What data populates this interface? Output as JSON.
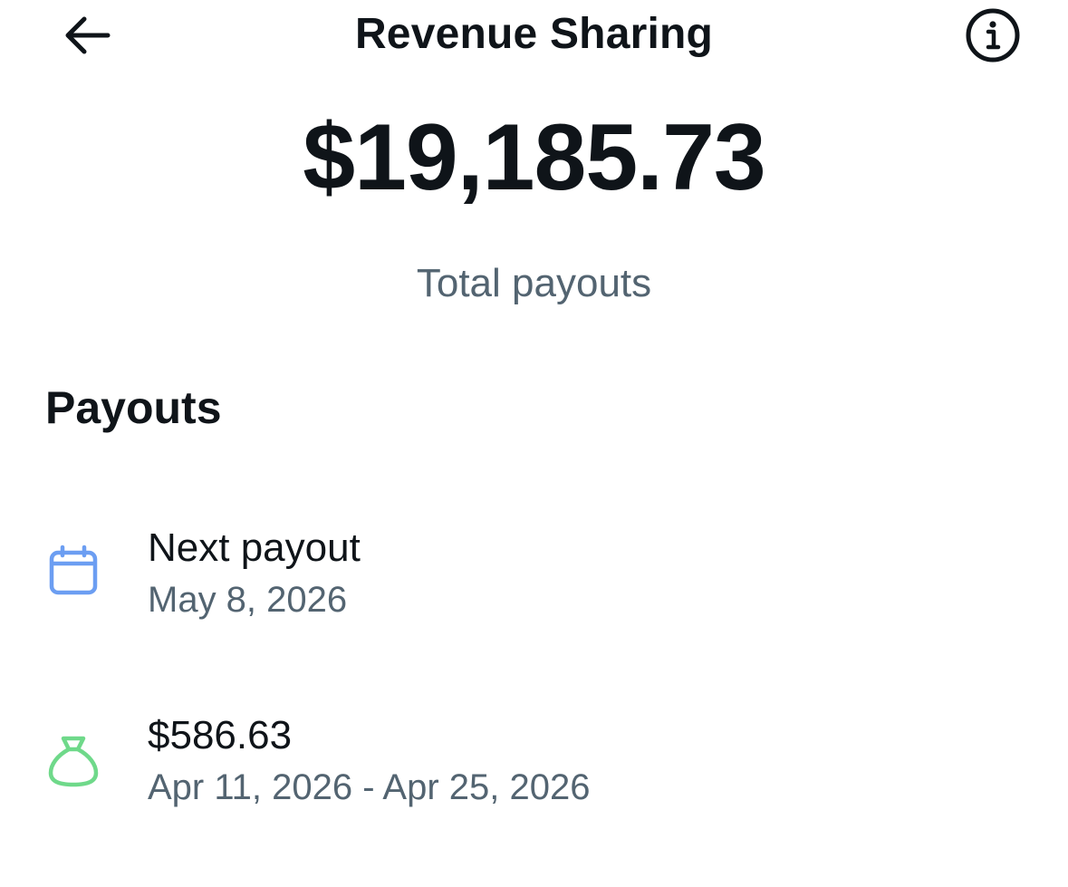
{
  "header": {
    "back_icon": "arrow-left-icon",
    "title": "Revenue Sharing",
    "info_icon": "info-circle-icon"
  },
  "summary": {
    "total_amount": "$19,185.73",
    "total_label": "Total payouts"
  },
  "payouts": {
    "section_title": "Payouts",
    "items": [
      {
        "icon": "calendar-icon",
        "icon_color": "#6c9ef2",
        "primary": "Next payout",
        "secondary": "May 8, 2026"
      },
      {
        "icon": "money-bag-icon",
        "icon_color": "#6fd98a",
        "primary": "$586.63",
        "secondary": "Apr 11, 2026 - Apr 25, 2026"
      }
    ]
  }
}
